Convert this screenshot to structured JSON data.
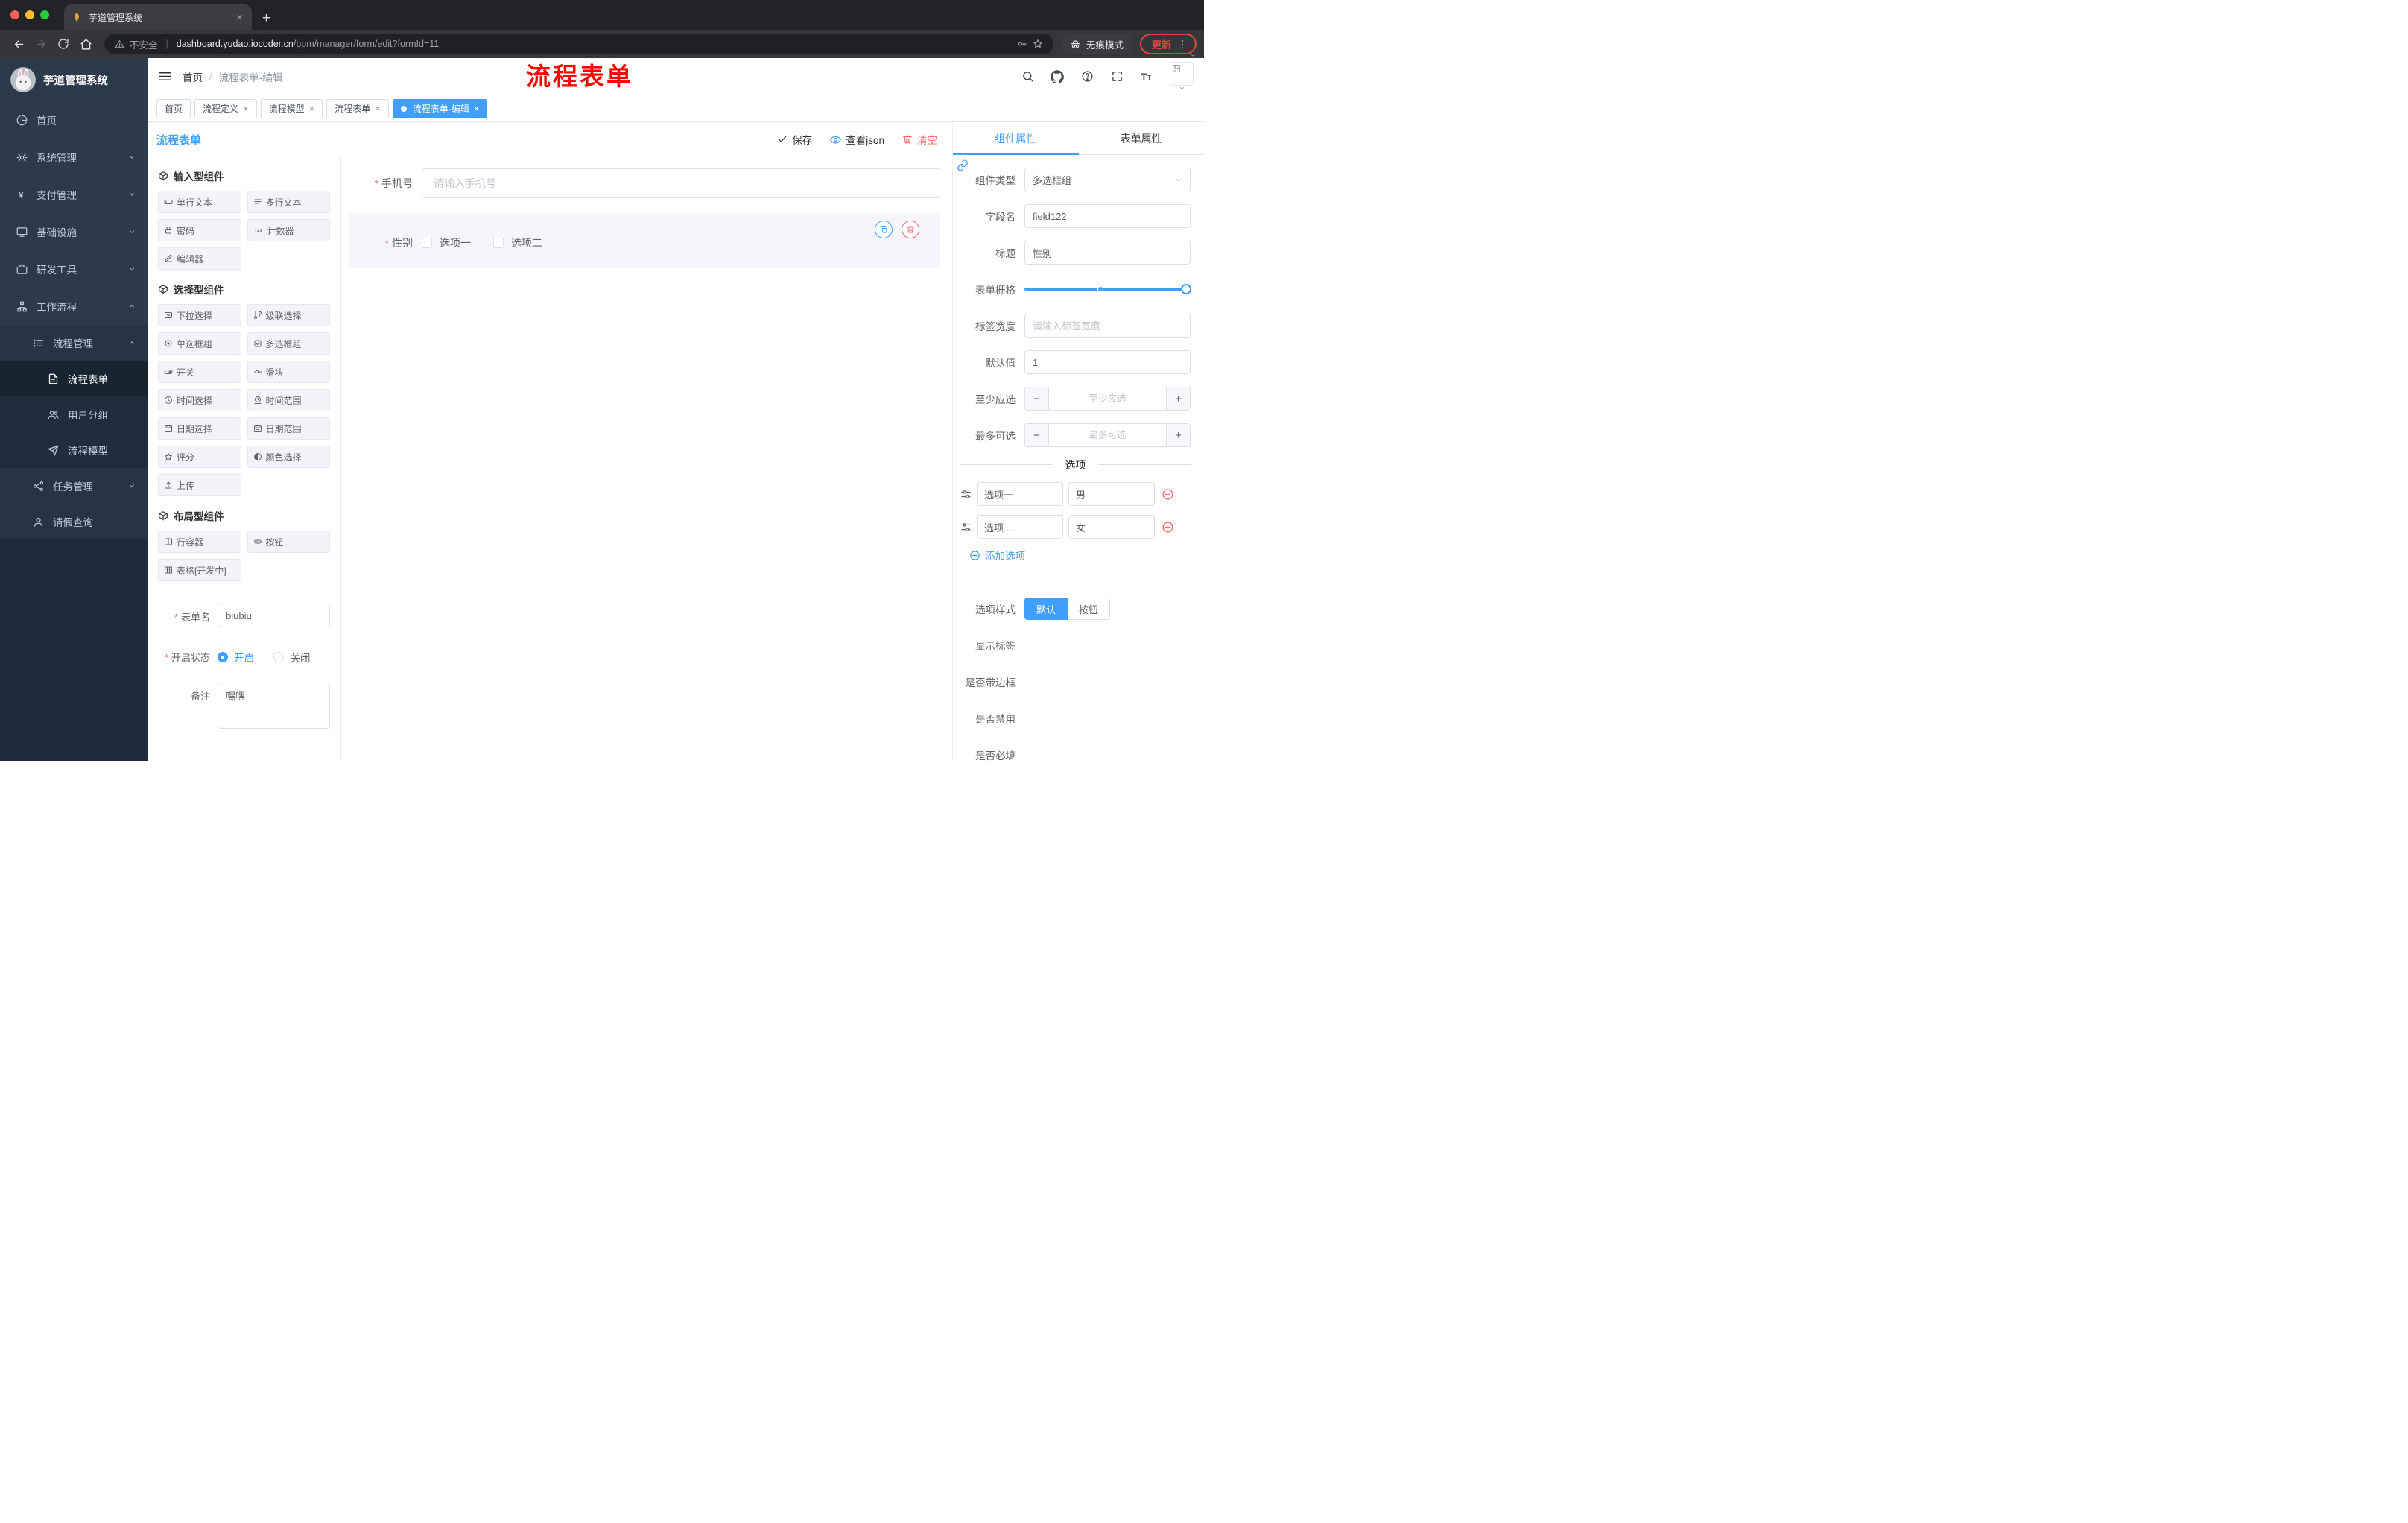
{
  "colors": {
    "primary": "#409eff",
    "danger": "#f56c6c",
    "annotation": "#fb0500"
  },
  "browser": {
    "tab_title": "芋道管理系统",
    "security_label": "不安全",
    "url_domain": "dashboard.yudao.iocoder.cn",
    "url_path": "/bpm/manager/form/edit?formId=11",
    "incognito_label": "无痕模式",
    "update_label": "更新"
  },
  "sidebar": {
    "logo_title": "芋道管理系统",
    "items": [
      {
        "label": "首页"
      },
      {
        "label": "系统管理"
      },
      {
        "label": "支付管理"
      },
      {
        "label": "基础设施"
      },
      {
        "label": "研发工具"
      },
      {
        "label": "工作流程"
      },
      {
        "label": "流程管理"
      },
      {
        "label": "流程表单"
      },
      {
        "label": "用户分组"
      },
      {
        "label": "流程模型"
      },
      {
        "label": "任务管理"
      },
      {
        "label": "请假查询"
      }
    ]
  },
  "header": {
    "breadcrumb_home": "首页",
    "breadcrumb_current": "流程表单-编辑",
    "annotation": "流程表单"
  },
  "tagbar": {
    "tags": [
      {
        "label": "首页"
      },
      {
        "label": "流程定义"
      },
      {
        "label": "流程模型"
      },
      {
        "label": "流程表单"
      },
      {
        "label": "流程表单-编辑"
      }
    ]
  },
  "editor": {
    "title": "流程表单",
    "save_label": "保存",
    "view_json_label": "查看json",
    "clear_label": "清空"
  },
  "palette": {
    "sections": [
      {
        "title": "输入型组件",
        "items": [
          {
            "label": "单行文本"
          },
          {
            "label": "多行文本"
          },
          {
            "label": "密码"
          },
          {
            "label": "计数器"
          },
          {
            "label": "编辑器"
          }
        ]
      },
      {
        "title": "选择型组件",
        "items": [
          {
            "label": "下拉选择"
          },
          {
            "label": "级联选择"
          },
          {
            "label": "单选框组"
          },
          {
            "label": "多选框组"
          },
          {
            "label": "开关"
          },
          {
            "label": "滑块"
          },
          {
            "label": "时间选择"
          },
          {
            "label": "时间范围"
          },
          {
            "label": "日期选择"
          },
          {
            "label": "日期范围"
          },
          {
            "label": "评分"
          },
          {
            "label": "颜色选择"
          },
          {
            "label": "上传"
          }
        ]
      },
      {
        "title": "布局型组件",
        "items": [
          {
            "label": "行容器"
          },
          {
            "label": "按钮"
          },
          {
            "label": "表格[开发中]"
          }
        ]
      }
    ],
    "meta": {
      "form_name_label": "表单名",
      "form_name_value": "biubiu",
      "status_label": "开启状态",
      "status_on": "开启",
      "status_off": "关闭",
      "remark_label": "备注",
      "remark_value": "嘿嘿"
    }
  },
  "canvas": {
    "phone_label": "手机号",
    "phone_placeholder": "请输入手机号",
    "gender_label": "性别",
    "gender_options": [
      {
        "label": "选项一"
      },
      {
        "label": "选项二"
      }
    ]
  },
  "props": {
    "tab_component": "组件属性",
    "tab_form": "表单属性",
    "component_type_label": "组件类型",
    "component_type_value": "多选框组",
    "field_name_label": "字段名",
    "field_name_value": "field122",
    "title_label": "标题",
    "title_value": "性别",
    "grid_label": "表单栅格",
    "label_width_label": "标签宽度",
    "label_width_placeholder": "请输入标签宽度",
    "default_label": "默认值",
    "default_value": "1",
    "min_label": "至少应选",
    "min_placeholder": "至少应选",
    "max_label": "最多可选",
    "max_placeholder": "最多可选",
    "options_title": "选项",
    "option_rows": [
      {
        "label": "选项一",
        "value": "男"
      },
      {
        "label": "选项二",
        "value": "女"
      }
    ],
    "add_option_label": "添加选项",
    "option_style_label": "选项样式",
    "style_default": "默认",
    "style_button": "按钮",
    "show_label_label": "显示标签",
    "border_label": "是否带边框",
    "disabled_label": "是否禁用",
    "required_label": "是否必填"
  }
}
